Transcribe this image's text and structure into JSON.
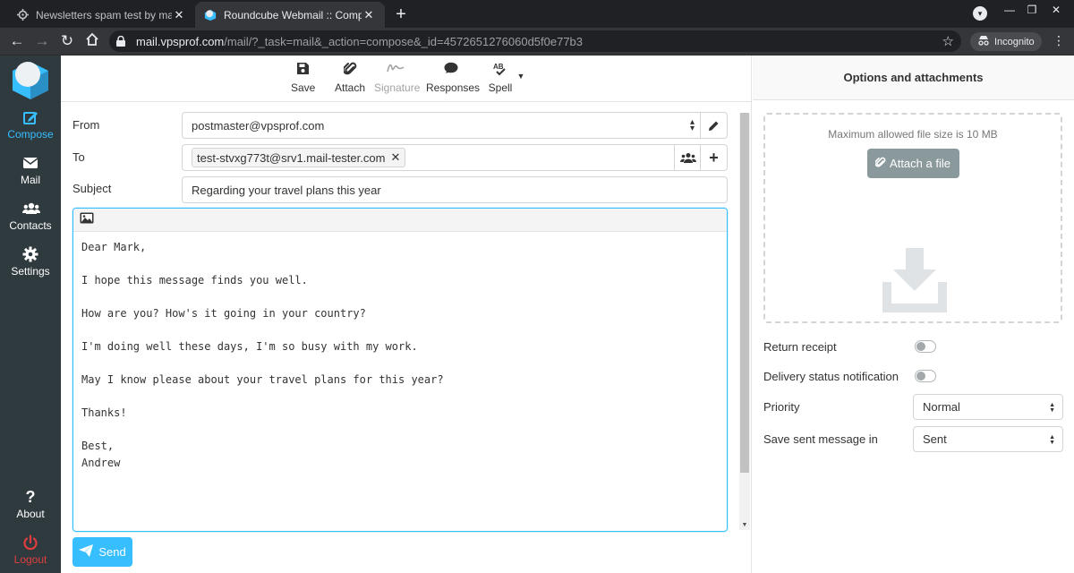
{
  "browser": {
    "tabs": [
      {
        "title": "Newsletters spam test by mail-te",
        "active": false
      },
      {
        "title": "Roundcube Webmail :: Compose",
        "active": true
      }
    ],
    "address": {
      "host": "mail.vpsprof.com",
      "path": "/mail/?_task=mail&_action=compose&_id=4572651276060d5f0e77b3"
    },
    "incognito_label": "Incognito"
  },
  "nav": {
    "compose": "Compose",
    "mail": "Mail",
    "contacts": "Contacts",
    "settings": "Settings",
    "about": "About",
    "logout": "Logout"
  },
  "compose_toolbar": {
    "save": "Save",
    "attach": "Attach",
    "signature": "Signature",
    "responses": "Responses",
    "spell": "Spell"
  },
  "form": {
    "from_label": "From",
    "from_value": "postmaster@vpsprof.com",
    "to_label": "To",
    "to_recipient": "test-stvxg773t@srv1.mail-tester.com",
    "subject_label": "Subject",
    "subject_value": "Regarding your travel plans this year"
  },
  "message_body": "Dear Mark,\n\nI hope this message finds you well.\n\nHow are you? How's it going in your country?\n\nI'm doing well these days, I'm so busy with my work.\n\nMay I know please about your travel plans for this year?\n\nThanks!\n\nBest,\nAndrew",
  "send_label": "Send",
  "options": {
    "title": "Options and attachments",
    "max_size": "Maximum allowed file size is 10 MB",
    "attach_file": "Attach a file",
    "return_receipt": "Return receipt",
    "return_receipt_on": false,
    "delivery_status": "Delivery status notification",
    "delivery_status_on": false,
    "priority_label": "Priority",
    "priority_value": "Normal",
    "save_sent_label": "Save sent message in",
    "save_sent_value": "Sent"
  },
  "colors": {
    "accent": "#37beff",
    "nav_bg": "#2f3a3f",
    "logout": "#e03e3e",
    "attach_button": "#8a999c"
  }
}
